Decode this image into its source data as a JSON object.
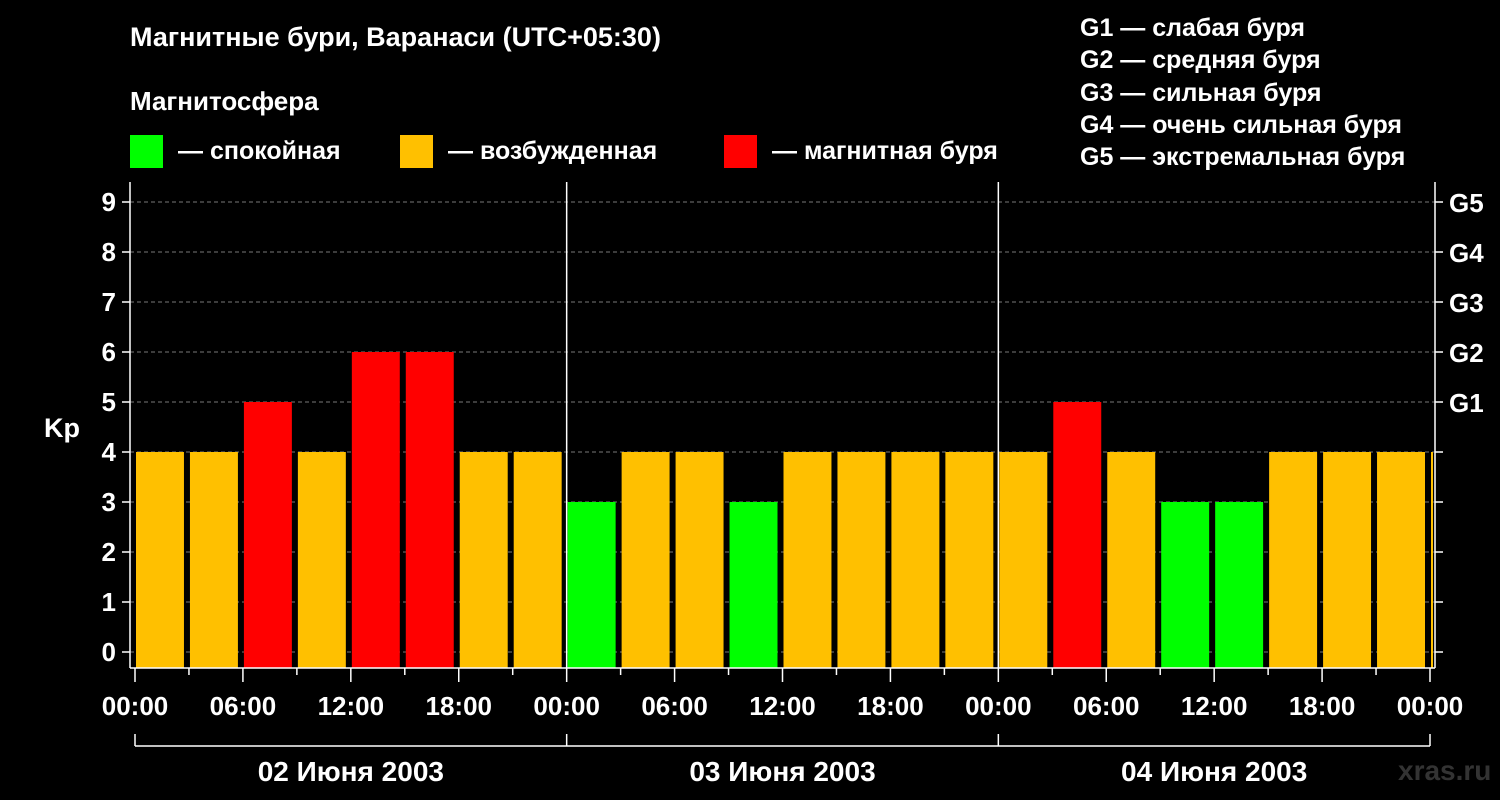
{
  "title": "Магнитные бури, Варанаси (UTC+05:30)",
  "magnetosphere": {
    "title": "Магнитосфера",
    "items": [
      {
        "label": "— спокойная",
        "color": "#00ff00"
      },
      {
        "label": "— возбужденная",
        "color": "#ffc000"
      },
      {
        "label": "— магнитная буря",
        "color": "#ff0000"
      }
    ]
  },
  "g_legend": [
    "G1 — слабая буря",
    "G2 — средняя буря",
    "G3 — сильная буря",
    "G4 — очень сильная буря",
    "G5 — экстремальная буря"
  ],
  "watermark": "xras.ru",
  "chart_data": {
    "type": "bar",
    "ylabel": "Kp",
    "ylim": [
      0,
      9
    ],
    "yticks": [
      "0",
      "1",
      "2",
      "3",
      "4",
      "5",
      "6",
      "7",
      "8",
      "9"
    ],
    "right_ticks": [
      {
        "value": 5,
        "label": "G1"
      },
      {
        "value": 6,
        "label": "G2"
      },
      {
        "value": 7,
        "label": "G3"
      },
      {
        "value": 8,
        "label": "G4"
      },
      {
        "value": 9,
        "label": "G5"
      }
    ],
    "x_tick_labels": [
      "00:00",
      "06:00",
      "12:00",
      "18:00",
      "00:00",
      "06:00",
      "12:00",
      "18:00",
      "00:00",
      "06:00",
      "12:00",
      "18:00",
      "00:00"
    ],
    "days": [
      "02 Июня 2003",
      "03 Июня 2003",
      "04 Июня 2003"
    ],
    "interval_hours": 3,
    "values": [
      4,
      4,
      5,
      4,
      6,
      6,
      4,
      4,
      3,
      4,
      4,
      3,
      4,
      4,
      4,
      4,
      4,
      5,
      4,
      3,
      3,
      4,
      4,
      4,
      4
    ],
    "thresholds": {
      "quiet_max": 3,
      "storm_min": 5
    },
    "colors": {
      "quiet": "#00ff00",
      "active": "#ffc000",
      "storm": "#ff0000"
    },
    "grid": "dashed"
  }
}
